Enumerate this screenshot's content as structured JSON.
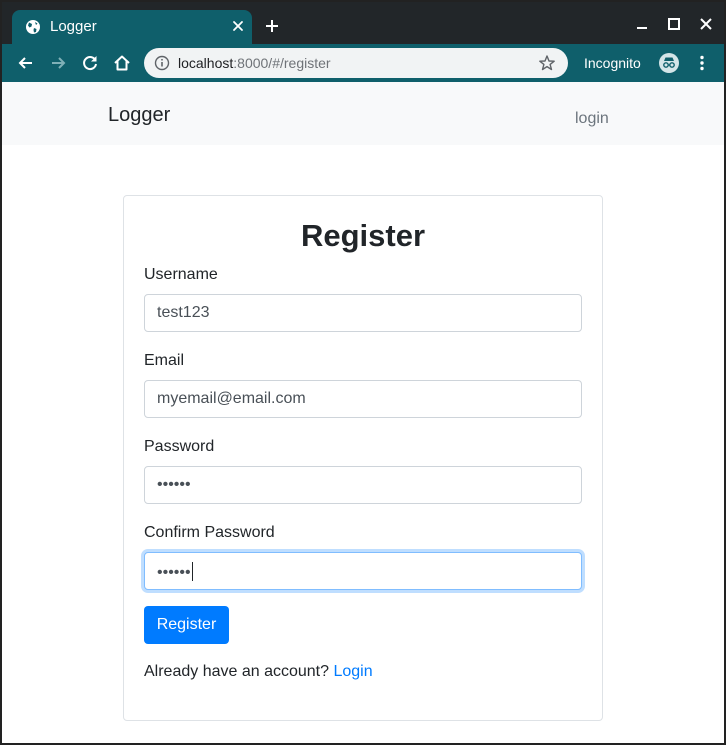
{
  "browser": {
    "tab_title": "Logger",
    "url_host": "localhost",
    "url_path": ":8000/#/register",
    "incognito_label": "Incognito"
  },
  "navbar": {
    "brand": "Logger",
    "login_link": "login"
  },
  "form": {
    "title": "Register",
    "username_label": "Username",
    "username_value": "test123",
    "email_label": "Email",
    "email_value": "myemail@email.com",
    "password_label": "Password",
    "password_value": "••••••",
    "confirm_label": "Confirm Password",
    "confirm_value": "••••••",
    "submit_label": "Register",
    "already_text": "Already have an account?",
    "login_link": "Login"
  },
  "colors": {
    "browser_accent": "#0f5f6b",
    "primary": "#007bff",
    "focus_border": "#80bdff",
    "navbar_bg": "#f8f9fa"
  },
  "icons": {
    "tab": [
      "globe-icon",
      "close-icon",
      "plus-icon"
    ],
    "window": [
      "minimize-icon",
      "maximize-icon",
      "close-window-icon"
    ],
    "toolbar": [
      "back-arrow-icon",
      "forward-arrow-icon",
      "reload-icon",
      "home-icon",
      "info-icon",
      "star-icon",
      "incognito-icon",
      "more-vert-icon"
    ]
  }
}
